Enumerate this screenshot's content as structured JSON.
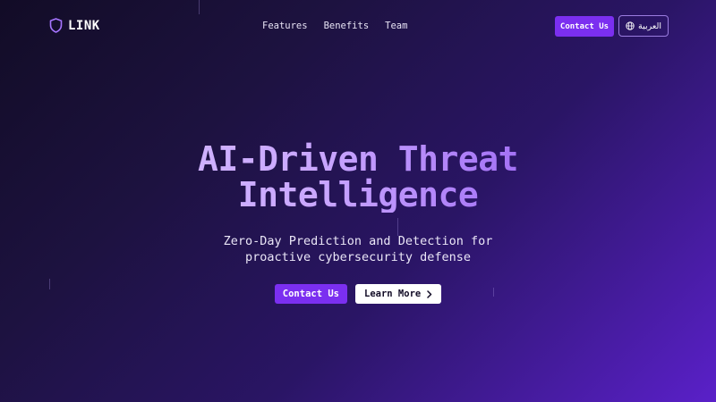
{
  "brand": {
    "name": "LINK",
    "icon": "shield-icon"
  },
  "nav": {
    "links": [
      {
        "label": "Features"
      },
      {
        "label": "Benefits"
      },
      {
        "label": "Team"
      }
    ],
    "contact_label": "Contact Us",
    "language_label": "العربية",
    "language_icon": "globe-icon"
  },
  "hero": {
    "title_line1": "AI-Driven Threat",
    "title_line2": "Intelligence",
    "subtitle_line1": "Zero-Day Prediction and Detection for",
    "subtitle_line2": "proactive cybersecurity defense",
    "primary_button": "Contact Us",
    "secondary_button": "Learn More",
    "secondary_icon": "chevron-right-icon"
  },
  "colors": {
    "accent": "#7b2ff0",
    "background_start": "#120c26",
    "background_end": "#5a20c9",
    "title_gradient": "#c9a6ff"
  }
}
